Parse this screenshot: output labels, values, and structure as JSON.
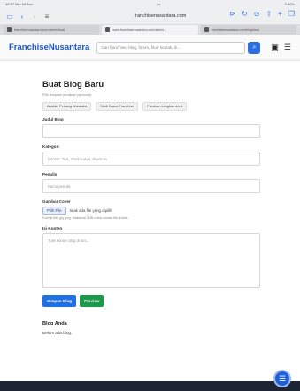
{
  "status": {
    "time": "12.37",
    "date": "Min 14 Jun",
    "dots": "•••",
    "battery": "0.80%"
  },
  "browser": {
    "url": "franchisenusantara.com"
  },
  "tabs": [
    {
      "label": "franchisenusantara.com/admin/buat"
    },
    {
      "label": "www.franchisenusantara.com/admin..."
    },
    {
      "label": "franchisenusantara.com/blog/buat"
    }
  ],
  "nav": {
    "brand": "FranchiseNusantara",
    "search_placeholder": "Cari franchise, blog, forum, fitur, kontak, di..."
  },
  "form": {
    "title": "Buat Blog Baru",
    "hint": "Pilih template penulisan (opsional):",
    "chips": [
      "Analisis Peluang Waralaba",
      "Studi Kasus Franchise",
      "Panduan Langkah demi"
    ],
    "judul_label": "Judul Blog",
    "kategori_label": "Kategori",
    "kategori_placeholder": "Contoh: Tips, Studi Kasus, Panduan",
    "penulis_label": "Penulis",
    "penulis_placeholder": "Nama penulis",
    "gambar_label": "Gambar Cover",
    "file_button": "Pilih File",
    "file_status": "tidak ada file yang dipilih",
    "file_hint": "Format file: jpg, png. Maksimal 2MB untuk ukuran file terbaik.",
    "isi_label": "Isi Konten",
    "isi_placeholder": "Tulis konten blog di sini...",
    "save_label": "Simpan Blog",
    "preview_label": "Preview"
  },
  "blog_list": {
    "title": "Blog Anda",
    "empty": "Belum ada blog."
  }
}
